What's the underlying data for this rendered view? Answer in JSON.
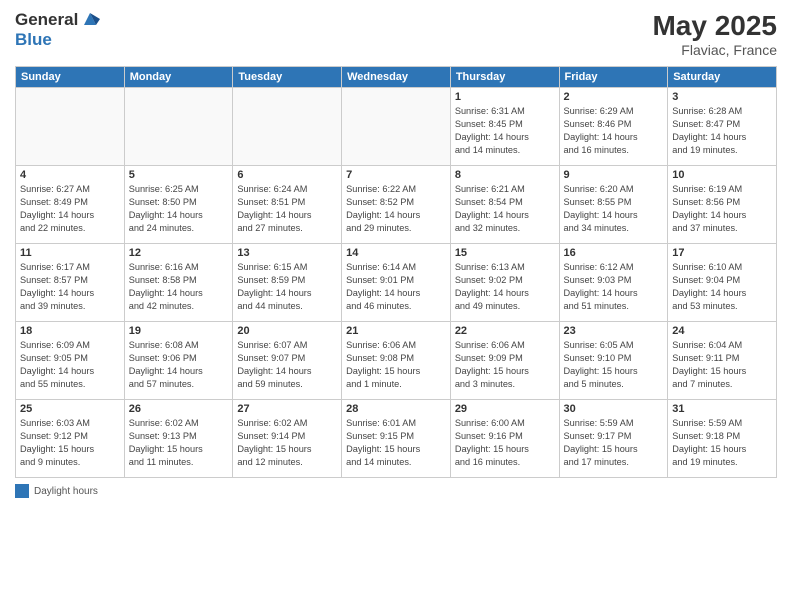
{
  "header": {
    "logo_line1": "General",
    "logo_line2": "Blue",
    "month_year": "May 2025",
    "location": "Flaviac, France"
  },
  "days_of_week": [
    "Sunday",
    "Monday",
    "Tuesday",
    "Wednesday",
    "Thursday",
    "Friday",
    "Saturday"
  ],
  "legend": {
    "label": "Daylight hours"
  },
  "weeks": [
    [
      {
        "day": "",
        "info": ""
      },
      {
        "day": "",
        "info": ""
      },
      {
        "day": "",
        "info": ""
      },
      {
        "day": "",
        "info": ""
      },
      {
        "day": "1",
        "info": "Sunrise: 6:31 AM\nSunset: 8:45 PM\nDaylight: 14 hours\nand 14 minutes."
      },
      {
        "day": "2",
        "info": "Sunrise: 6:29 AM\nSunset: 8:46 PM\nDaylight: 14 hours\nand 16 minutes."
      },
      {
        "day": "3",
        "info": "Sunrise: 6:28 AM\nSunset: 8:47 PM\nDaylight: 14 hours\nand 19 minutes."
      }
    ],
    [
      {
        "day": "4",
        "info": "Sunrise: 6:27 AM\nSunset: 8:49 PM\nDaylight: 14 hours\nand 22 minutes."
      },
      {
        "day": "5",
        "info": "Sunrise: 6:25 AM\nSunset: 8:50 PM\nDaylight: 14 hours\nand 24 minutes."
      },
      {
        "day": "6",
        "info": "Sunrise: 6:24 AM\nSunset: 8:51 PM\nDaylight: 14 hours\nand 27 minutes."
      },
      {
        "day": "7",
        "info": "Sunrise: 6:22 AM\nSunset: 8:52 PM\nDaylight: 14 hours\nand 29 minutes."
      },
      {
        "day": "8",
        "info": "Sunrise: 6:21 AM\nSunset: 8:54 PM\nDaylight: 14 hours\nand 32 minutes."
      },
      {
        "day": "9",
        "info": "Sunrise: 6:20 AM\nSunset: 8:55 PM\nDaylight: 14 hours\nand 34 minutes."
      },
      {
        "day": "10",
        "info": "Sunrise: 6:19 AM\nSunset: 8:56 PM\nDaylight: 14 hours\nand 37 minutes."
      }
    ],
    [
      {
        "day": "11",
        "info": "Sunrise: 6:17 AM\nSunset: 8:57 PM\nDaylight: 14 hours\nand 39 minutes."
      },
      {
        "day": "12",
        "info": "Sunrise: 6:16 AM\nSunset: 8:58 PM\nDaylight: 14 hours\nand 42 minutes."
      },
      {
        "day": "13",
        "info": "Sunrise: 6:15 AM\nSunset: 8:59 PM\nDaylight: 14 hours\nand 44 minutes."
      },
      {
        "day": "14",
        "info": "Sunrise: 6:14 AM\nSunset: 9:01 PM\nDaylight: 14 hours\nand 46 minutes."
      },
      {
        "day": "15",
        "info": "Sunrise: 6:13 AM\nSunset: 9:02 PM\nDaylight: 14 hours\nand 49 minutes."
      },
      {
        "day": "16",
        "info": "Sunrise: 6:12 AM\nSunset: 9:03 PM\nDaylight: 14 hours\nand 51 minutes."
      },
      {
        "day": "17",
        "info": "Sunrise: 6:10 AM\nSunset: 9:04 PM\nDaylight: 14 hours\nand 53 minutes."
      }
    ],
    [
      {
        "day": "18",
        "info": "Sunrise: 6:09 AM\nSunset: 9:05 PM\nDaylight: 14 hours\nand 55 minutes."
      },
      {
        "day": "19",
        "info": "Sunrise: 6:08 AM\nSunset: 9:06 PM\nDaylight: 14 hours\nand 57 minutes."
      },
      {
        "day": "20",
        "info": "Sunrise: 6:07 AM\nSunset: 9:07 PM\nDaylight: 14 hours\nand 59 minutes."
      },
      {
        "day": "21",
        "info": "Sunrise: 6:06 AM\nSunset: 9:08 PM\nDaylight: 15 hours\nand 1 minute."
      },
      {
        "day": "22",
        "info": "Sunrise: 6:06 AM\nSunset: 9:09 PM\nDaylight: 15 hours\nand 3 minutes."
      },
      {
        "day": "23",
        "info": "Sunrise: 6:05 AM\nSunset: 9:10 PM\nDaylight: 15 hours\nand 5 minutes."
      },
      {
        "day": "24",
        "info": "Sunrise: 6:04 AM\nSunset: 9:11 PM\nDaylight: 15 hours\nand 7 minutes."
      }
    ],
    [
      {
        "day": "25",
        "info": "Sunrise: 6:03 AM\nSunset: 9:12 PM\nDaylight: 15 hours\nand 9 minutes."
      },
      {
        "day": "26",
        "info": "Sunrise: 6:02 AM\nSunset: 9:13 PM\nDaylight: 15 hours\nand 11 minutes."
      },
      {
        "day": "27",
        "info": "Sunrise: 6:02 AM\nSunset: 9:14 PM\nDaylight: 15 hours\nand 12 minutes."
      },
      {
        "day": "28",
        "info": "Sunrise: 6:01 AM\nSunset: 9:15 PM\nDaylight: 15 hours\nand 14 minutes."
      },
      {
        "day": "29",
        "info": "Sunrise: 6:00 AM\nSunset: 9:16 PM\nDaylight: 15 hours\nand 16 minutes."
      },
      {
        "day": "30",
        "info": "Sunrise: 5:59 AM\nSunset: 9:17 PM\nDaylight: 15 hours\nand 17 minutes."
      },
      {
        "day": "31",
        "info": "Sunrise: 5:59 AM\nSunset: 9:18 PM\nDaylight: 15 hours\nand 19 minutes."
      }
    ]
  ]
}
